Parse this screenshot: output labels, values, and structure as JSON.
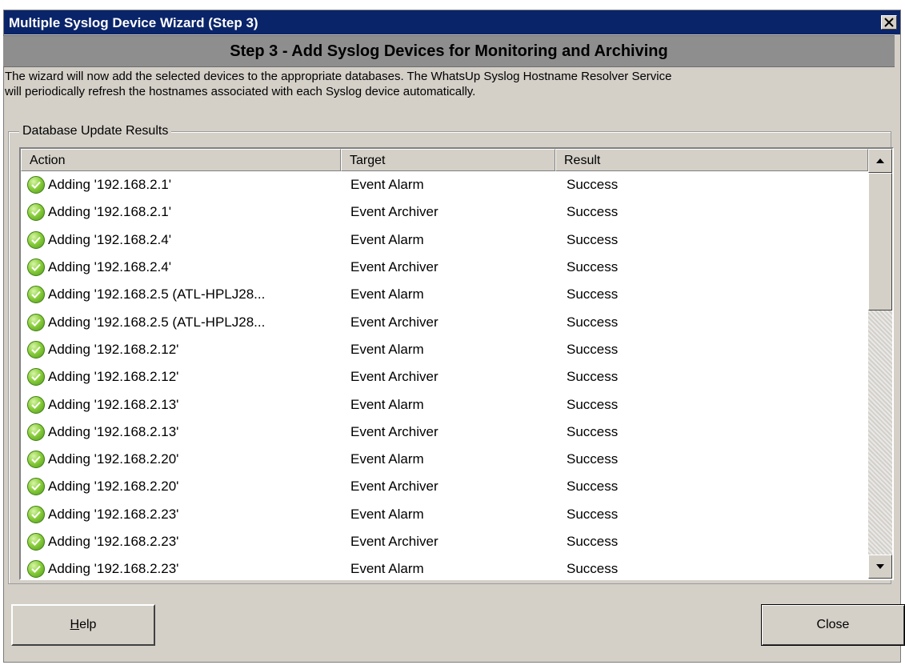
{
  "window": {
    "title": "Multiple Syslog Device Wizard (Step 3)"
  },
  "step": {
    "heading": "Step 3 - Add Syslog Devices for Monitoring and Archiving",
    "description_line1": "The wizard will now add the selected devices to the appropriate databases.  The WhatsUp Syslog Hostname Resolver Service",
    "description_line2": "will periodically refresh the hostnames associated with each Syslog device automatically."
  },
  "group": {
    "label": "Database Update Results"
  },
  "table": {
    "columns": [
      "Action",
      "Target",
      "Result"
    ],
    "rows": [
      {
        "action": "Adding '192.168.2.1'",
        "target": "Event Alarm",
        "result": "Success"
      },
      {
        "action": "Adding '192.168.2.1'",
        "target": "Event Archiver",
        "result": "Success"
      },
      {
        "action": "Adding '192.168.2.4'",
        "target": "Event Alarm",
        "result": "Success"
      },
      {
        "action": "Adding '192.168.2.4'",
        "target": "Event Archiver",
        "result": "Success"
      },
      {
        "action": "Adding '192.168.2.5 (ATL-HPLJ28...",
        "target": "Event Alarm",
        "result": "Success"
      },
      {
        "action": "Adding '192.168.2.5 (ATL-HPLJ28...",
        "target": "Event Archiver",
        "result": "Success"
      },
      {
        "action": "Adding '192.168.2.12'",
        "target": "Event Alarm",
        "result": "Success"
      },
      {
        "action": "Adding '192.168.2.12'",
        "target": "Event Archiver",
        "result": "Success"
      },
      {
        "action": "Adding '192.168.2.13'",
        "target": "Event Alarm",
        "result": "Success"
      },
      {
        "action": "Adding '192.168.2.13'",
        "target": "Event Archiver",
        "result": "Success"
      },
      {
        "action": "Adding '192.168.2.20'",
        "target": "Event Alarm",
        "result": "Success"
      },
      {
        "action": "Adding '192.168.2.20'",
        "target": "Event Archiver",
        "result": "Success"
      },
      {
        "action": "Adding '192.168.2.23'",
        "target": "Event Alarm",
        "result": "Success"
      },
      {
        "action": "Adding '192.168.2.23'",
        "target": "Event Archiver",
        "result": "Success"
      },
      {
        "action": "Adding '192.168.2.23'",
        "target": "Event Alarm",
        "result": "Success"
      }
    ],
    "row_icon": "checkmark-success-icon"
  },
  "buttons": {
    "help": "Help",
    "close": "Close"
  },
  "colors": {
    "titlebar": "#0a246a",
    "dialog_bg": "#d4d0c8",
    "banner_bg": "#8e8e8e",
    "success_icon": "#8ccf3d"
  }
}
